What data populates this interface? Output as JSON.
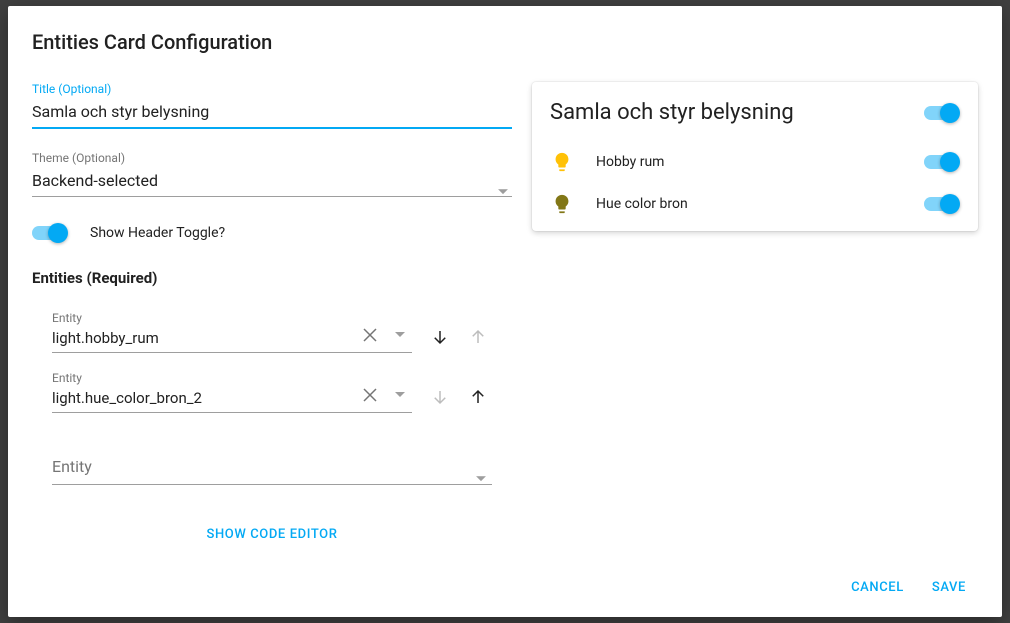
{
  "dialogTitle": "Entities Card Configuration",
  "fields": {
    "titleLabel": "Title (Optional)",
    "titleValue": "Samla och styr belysning",
    "themeLabel": "Theme (Optional)",
    "themeValue": "Backend-selected",
    "headerToggleLabel": "Show Header Toggle?"
  },
  "entitiesHeading": "Entities (Required)",
  "entities": [
    {
      "label": "Entity",
      "value": "light.hobby_rum",
      "canMoveDown": true,
      "canMoveUp": false
    },
    {
      "label": "Entity",
      "value": "light.hue_color_bron_2",
      "canMoveDown": false,
      "canMoveUp": true
    }
  ],
  "emptyEntityPlaceholder": "Entity",
  "codeEditorLabel": "SHOW CODE EDITOR",
  "actions": {
    "cancel": "CANCEL",
    "save": "SAVE"
  },
  "preview": {
    "title": "Samla och styr belysning",
    "rows": [
      {
        "name": "Hobby rum",
        "bulbColor": "#ffc107",
        "on": true
      },
      {
        "name": "Hue color bron",
        "bulbColor": "#827717",
        "on": true
      }
    ]
  }
}
